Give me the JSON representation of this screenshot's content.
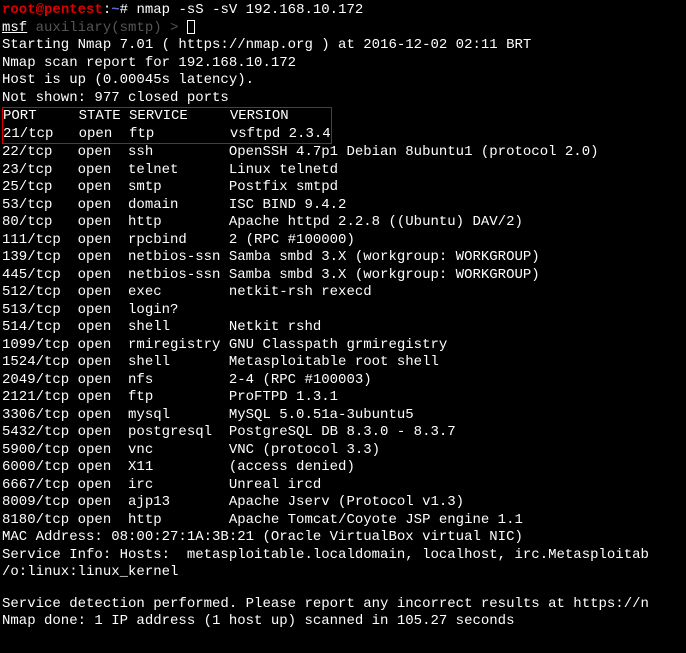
{
  "prompt": {
    "user": "root",
    "at": "@",
    "host": "pentest",
    "colon": ":",
    "path": "~",
    "hash": "#",
    "command": "nmap -sS -sV 192.168.10.172"
  },
  "msf_line": {
    "msf": "msf",
    "aux": " auxiliary(",
    "smtp": "smtp",
    "end": ") > "
  },
  "intro": {
    "l1": "Starting Nmap 7.01 ( https://nmap.org ) at 2016-12-02 02:11 BRT",
    "l2": "Nmap scan report for 192.168.10.172",
    "l3": "Host is up (0.00045s latency).",
    "l4": "Not shown: 977 closed ports"
  },
  "header": "PORT     STATE SERVICE     VERSION",
  "row21": "21/tcp   open  ftp         vsftpd 2.3.4",
  "rows": {
    "r22": "22/tcp   open  ssh         OpenSSH 4.7p1 Debian 8ubuntu1 (protocol 2.0)",
    "r23": "23/tcp   open  telnet      Linux telnetd",
    "r25": "25/tcp   open  smtp        Postfix smtpd",
    "r53": "53/tcp   open  domain      ISC BIND 9.4.2",
    "r80": "80/tcp   open  http        Apache httpd 2.2.8 ((Ubuntu) DAV/2)",
    "r111": "111/tcp  open  rpcbind     2 (RPC #100000)",
    "r139": "139/tcp  open  netbios-ssn Samba smbd 3.X (workgroup: WORKGROUP)",
    "r445": "445/tcp  open  netbios-ssn Samba smbd 3.X (workgroup: WORKGROUP)",
    "r512": "512/tcp  open  exec        netkit-rsh rexecd",
    "r513": "513/tcp  open  login?",
    "r514": "514/tcp  open  shell       Netkit rshd",
    "r1099": "1099/tcp open  rmiregistry GNU Classpath grmiregistry",
    "r1524": "1524/tcp open  shell       Metasploitable root shell",
    "r2049": "2049/tcp open  nfs         2-4 (RPC #100003)",
    "r2121": "2121/tcp open  ftp         ProFTPD 1.3.1",
    "r3306": "3306/tcp open  mysql       MySQL 5.0.51a-3ubuntu5",
    "r5432": "5432/tcp open  postgresql  PostgreSQL DB 8.3.0 - 8.3.7",
    "r5900": "5900/tcp open  vnc         VNC (protocol 3.3)",
    "r6000": "6000/tcp open  X11         (access denied)",
    "r6667": "6667/tcp open  irc         Unreal ircd",
    "r8009": "8009/tcp open  ajp13       Apache Jserv (Protocol v1.3)",
    "r8180": "8180/tcp open  http        Apache Tomcat/Coyote JSP engine 1.1"
  },
  "footer": {
    "mac": "MAC Address: 08:00:27:1A:3B:21 (Oracle VirtualBox virtual NIC)",
    "svc": "Service Info: Hosts:  metasploitable.localdomain, localhost, irc.Metasploitab",
    "os": "/o:linux:linux_kernel",
    "det": "Service detection performed. Please report any incorrect results at https://n",
    "done": "Nmap done: 1 IP address (1 host up) scanned in 105.27 seconds"
  }
}
